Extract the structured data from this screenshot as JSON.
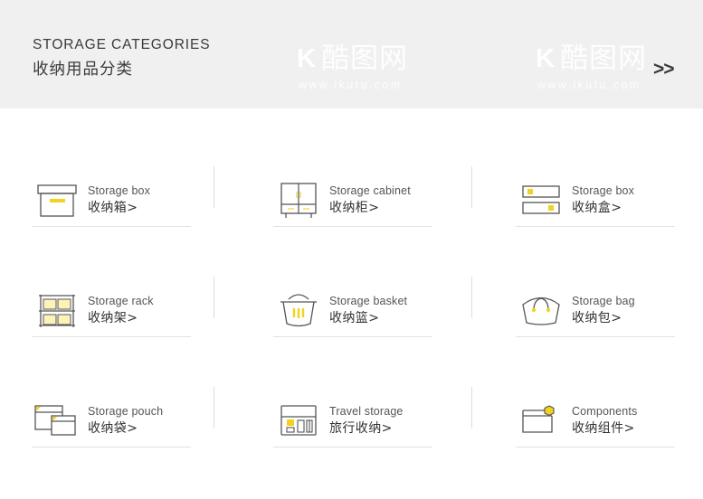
{
  "header": {
    "title_en": "STORAGE CATEGORIES",
    "title_cn": "收纳用品分类",
    "next_label": ">>",
    "background_color": "#f0f0f0",
    "watermark": {
      "logo_letter": "K",
      "logo_cn": "酷图网",
      "url": "www.ikutu.com"
    }
  },
  "theme": {
    "line_color": "#555555",
    "accent_color": "#f2d21e",
    "accent_color_soft": "#f7e58a",
    "divider_color": "#e2e2e2",
    "text_en_color": "#55555a",
    "text_cn_color": "#323232"
  },
  "grid": {
    "columns": 3,
    "rows": 3,
    "items": [
      {
        "id": "storage-box-bin",
        "label_en": "Storage box",
        "label_cn": "收纳箱>",
        "icon": "storage-box-icon"
      },
      {
        "id": "storage-cabinet",
        "label_en": "Storage cabinet",
        "label_cn": "收纳柜>",
        "icon": "storage-cabinet-icon"
      },
      {
        "id": "storage-box-stack",
        "label_en": "Storage box",
        "label_cn": "收纳盒>",
        "icon": "stacked-boxes-icon"
      },
      {
        "id": "storage-rack",
        "label_en": "Storage rack",
        "label_cn": "收纳架>",
        "icon": "storage-rack-icon"
      },
      {
        "id": "storage-basket",
        "label_en": "Storage basket",
        "label_cn": "收纳篮>",
        "icon": "storage-basket-icon"
      },
      {
        "id": "storage-bag",
        "label_en": "Storage bag",
        "label_cn": "收纳包>",
        "icon": "storage-bag-icon"
      },
      {
        "id": "storage-pouch",
        "label_en": "Storage pouch",
        "label_cn": "收纳袋>",
        "icon": "storage-pouch-icon"
      },
      {
        "id": "travel-storage",
        "label_en": "Travel storage",
        "label_cn": "旅行收纳>",
        "icon": "suitcase-icon"
      },
      {
        "id": "components",
        "label_en": "Components",
        "label_cn": "收纳组件>",
        "icon": "components-icon"
      }
    ]
  }
}
